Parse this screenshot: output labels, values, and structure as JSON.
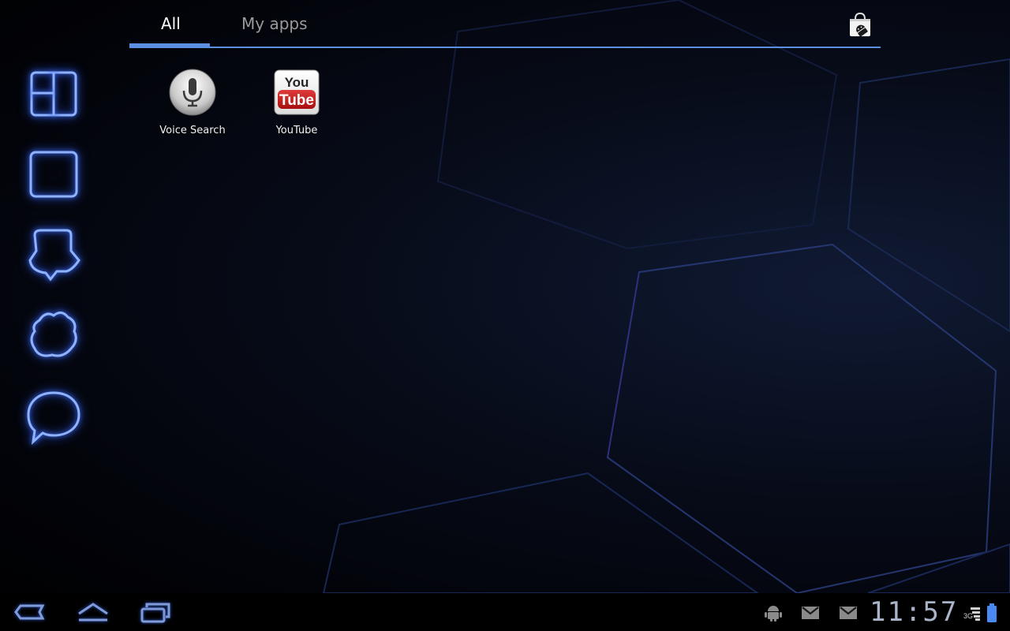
{
  "tabs": {
    "all_label": "All",
    "myapps_label": "My apps"
  },
  "toolbar": {
    "market_icon": "market-bag-icon"
  },
  "side_icons": [
    "widgets-icon",
    "square-icon",
    "bubble-icon",
    "blob-icon",
    "chat-icon"
  ],
  "apps": [
    {
      "label": "Voice Search",
      "icon": "microphone-icon"
    },
    {
      "label": "YouTube",
      "icon": "youtube-logo"
    }
  ],
  "youtube_logo": {
    "line1": "You",
    "line2": "Tube"
  },
  "system_bar": {
    "nav": [
      "back-icon",
      "home-icon",
      "recent-apps-icon"
    ],
    "notifications": [
      "android-debug-icon",
      "gmail-icon",
      "gmail-icon"
    ],
    "clock": "11:57",
    "network": "3G",
    "colors": {
      "accent": "#5b8fe2",
      "neon": "#8fb2ff"
    }
  }
}
